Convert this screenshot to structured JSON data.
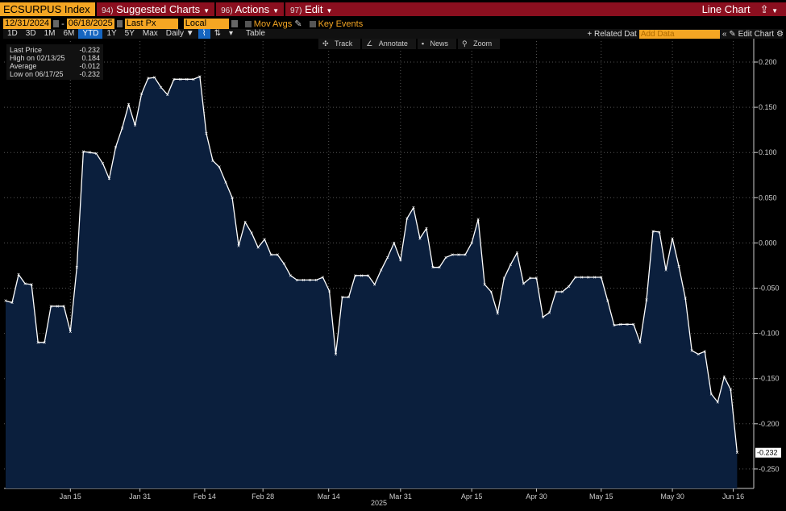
{
  "header": {
    "ticker": "ECSURPUS Index",
    "menus": [
      {
        "num": "94)",
        "label": "Suggested Charts"
      },
      {
        "num": "96)",
        "label": "Actions"
      },
      {
        "num": "97)",
        "label": "Edit"
      }
    ],
    "chart_type": "Line Chart"
  },
  "controls": {
    "start_date": "12/31/2024",
    "end_date": "06/18/2025",
    "field": "Last Px",
    "currency": "Local CCY",
    "mov_avgs": "Mov Avgs",
    "key_events": "Key Events",
    "dash": "-"
  },
  "periods": [
    "1D",
    "3D",
    "1M",
    "6M",
    "YTD",
    "1Y",
    "5Y",
    "Max"
  ],
  "active_period": "YTD",
  "frequency": "Daily ▼",
  "table_label": "Table",
  "related_data": "+ Related Dat",
  "add_data_placeholder": "Add Data",
  "edit_chart": "Edit Chart",
  "chart_tools": [
    "Track",
    "Annotate",
    "News",
    "Zoom"
  ],
  "legend": [
    {
      "label": "Last Price",
      "value": "-0.232"
    },
    {
      "label": "High on 02/13/25",
      "value": "0.184"
    },
    {
      "label": "Average",
      "value": "-0.012"
    },
    {
      "label": "Low on 06/17/25",
      "value": "-0.232"
    }
  ],
  "chart_data": {
    "type": "area",
    "title": "ECSURPUS Index",
    "xlabel": "2025",
    "ylim": [
      -0.27,
      0.225
    ],
    "yticks": [
      0.2,
      0.15,
      0.1,
      0.05,
      0.0,
      -0.05,
      -0.1,
      -0.15,
      -0.2,
      -0.25
    ],
    "ytick_labels": [
      "0.200",
      "0.150",
      "0.100",
      "0.050",
      "0.000",
      "-0.050",
      "-0.100",
      "-0.150",
      "-0.200",
      "-0.250"
    ],
    "xticks": [
      {
        "label": "Jan 15",
        "index": 10
      },
      {
        "label": "Jan 31",
        "index": 20.75
      },
      {
        "label": "Feb 14",
        "index": 30.75
      },
      {
        "label": "Feb 28",
        "index": 39.75
      },
      {
        "label": "Mar 14",
        "index": 49.9
      },
      {
        "label": "Mar 31",
        "index": 61
      },
      {
        "label": "Apr 15",
        "index": 72
      },
      {
        "label": "Apr 30",
        "index": 82
      },
      {
        "label": "May 15",
        "index": 92
      },
      {
        "label": "May 30",
        "index": 103
      },
      {
        "label": "Jun 16",
        "index": 112.4
      }
    ],
    "last_value_label": "-0.232",
    "color": "#ffffff",
    "fill": "#0b1f3d",
    "values": [
      -0.064,
      -0.066,
      -0.035,
      -0.045,
      -0.046,
      -0.11,
      -0.11,
      -0.07,
      -0.07,
      -0.07,
      -0.098,
      -0.027,
      0.101,
      0.1,
      0.099,
      0.088,
      0.071,
      0.106,
      0.127,
      0.153,
      0.13,
      0.165,
      0.182,
      0.183,
      0.172,
      0.164,
      0.181,
      0.181,
      0.181,
      0.181,
      0.184,
      0.121,
      0.091,
      0.084,
      0.067,
      0.05,
      -0.003,
      0.023,
      0.011,
      -0.005,
      0.004,
      -0.013,
      -0.013,
      -0.023,
      -0.036,
      -0.041,
      -0.041,
      -0.041,
      -0.041,
      -0.038,
      -0.053,
      -0.123,
      -0.06,
      -0.06,
      -0.036,
      -0.036,
      -0.036,
      -0.046,
      -0.03,
      -0.016,
      0.0,
      -0.019,
      0.027,
      0.039,
      0.005,
      0.016,
      -0.027,
      -0.027,
      -0.016,
      -0.013,
      -0.013,
      -0.013,
      0.0,
      0.026,
      -0.046,
      -0.054,
      -0.078,
      -0.039,
      -0.024,
      -0.011,
      -0.045,
      -0.039,
      -0.039,
      -0.082,
      -0.077,
      -0.054,
      -0.054,
      -0.048,
      -0.038,
      -0.038,
      -0.038,
      -0.038,
      -0.038,
      -0.064,
      -0.091,
      -0.09,
      -0.09,
      -0.09,
      -0.11,
      -0.063,
      0.013,
      0.012,
      -0.03,
      0.005,
      -0.026,
      -0.061,
      -0.119,
      -0.123,
      -0.12,
      -0.167,
      -0.176,
      -0.148,
      -0.162,
      -0.232
    ]
  }
}
